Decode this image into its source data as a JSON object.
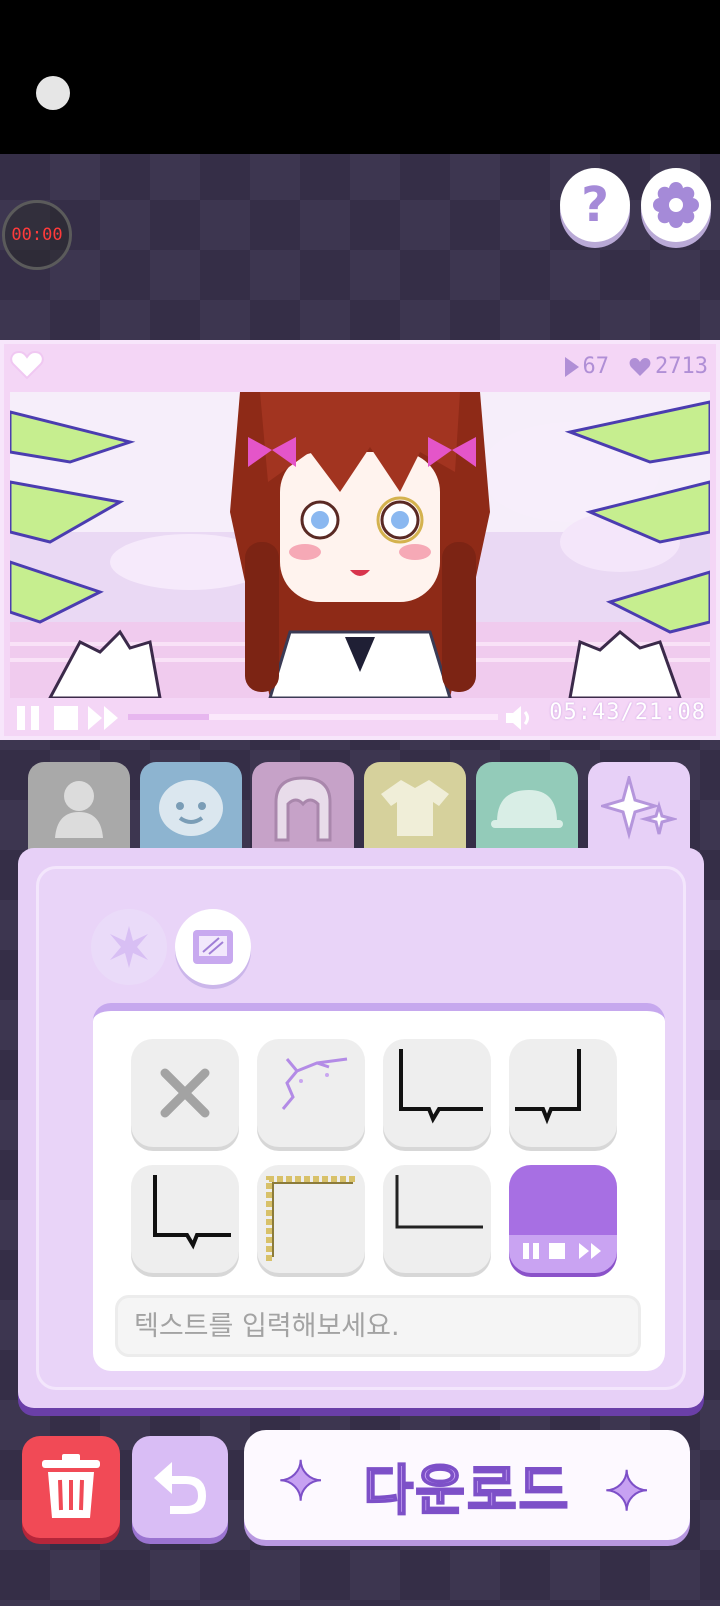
{
  "recorder": {
    "timer": "00:00"
  },
  "header": {
    "help_icon": "question-mark-icon",
    "settings_icon": "gear-icon"
  },
  "preview": {
    "views": "67",
    "likes": "2713",
    "time": "05:43/21:08",
    "progress": 0.22
  },
  "tabs": [
    {
      "icon": "person-silhouette-icon",
      "color": "#a9a9a9",
      "selected": false
    },
    {
      "icon": "face-icon",
      "color": "#8db4d0",
      "selected": false
    },
    {
      "icon": "hair-icon",
      "color": "#c6a2c8",
      "selected": false
    },
    {
      "icon": "shirt-icon",
      "color": "#d6d19c",
      "selected": false
    },
    {
      "icon": "hat-icon",
      "color": "#93cbb9",
      "selected": false
    },
    {
      "icon": "sparkle-icon",
      "color": "#e7d0f7",
      "selected": true
    }
  ],
  "panel": {
    "sub_tabs": [
      "effect-star-icon",
      "frame-icon"
    ],
    "selected_option": 7,
    "input_placeholder": "텍스트를 입력해보세요."
  },
  "actions": {
    "download_label": "다운로드"
  },
  "colors": {
    "accent": "#a76fe3",
    "trash": "#f14a56",
    "panel": "#e7d0f7"
  }
}
